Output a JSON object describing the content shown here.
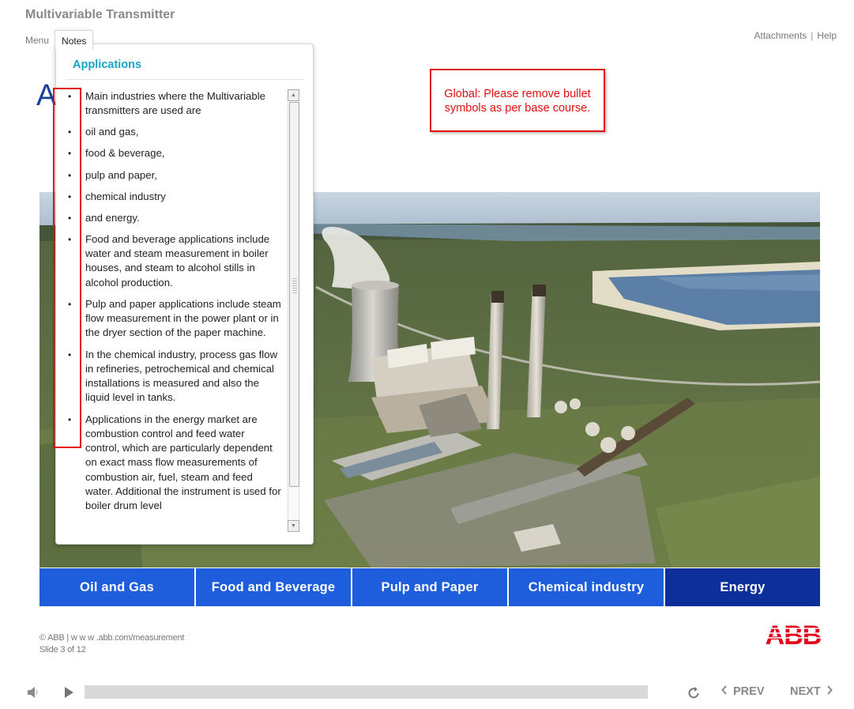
{
  "course": {
    "title": "Multivariable Transmitter"
  },
  "top_nav": {
    "menu": "Menu",
    "notes": "Notes",
    "attachments": "Attachments",
    "separator": "|",
    "help": "Help"
  },
  "slide": {
    "heading_partial": "A"
  },
  "notes": {
    "title": "Applications",
    "items": [
      "Main industries where the Multivariable transmitters are used are",
      "oil and gas,",
      "food & beverage,",
      "pulp and paper,",
      "chemical industry",
      "and energy.",
      "Food and beverage applications include water and steam measurement in boiler houses, and steam to alcohol stills in alcohol production.",
      "Pulp and paper applications include steam flow measurement in the power plant or in the dryer section of the paper machine.",
      "In the chemical industry, process gas flow in refineries, petrochemical and chemical installations is measured and also the liquid level in tanks.",
      "Applications in the energy market are combustion control and feed water control, which are particularly dependent on exact mass flow measurements of combustion air, fuel, steam and feed water.  Additional the instrument is used for boiler drum level"
    ]
  },
  "review_comment": "Global: Please remove bullet symbols as per base course.",
  "industry_tabs": [
    {
      "label": "Oil and Gas",
      "active": false
    },
    {
      "label": "Food and Beverage",
      "active": false
    },
    {
      "label": "Pulp and Paper",
      "active": false
    },
    {
      "label": "Chemical industry",
      "active": false
    },
    {
      "label": "Energy",
      "active": true
    }
  ],
  "footer": {
    "copyright": "© ABB | w w w .abb.com/measurement",
    "slide_counter": "Slide 3 of 12"
  },
  "logo": {
    "text": "ABB",
    "color": "#e2001a"
  },
  "player": {
    "prev": "PREV",
    "next": "NEXT",
    "progress_fraction": 0.0
  },
  "colors": {
    "tab_blue": "#1e5edc",
    "tab_active": "#0d2f9b",
    "notes_title": "#17a5c6",
    "comment_red": "#e01010"
  },
  "icons": [
    "audio-icon",
    "play-icon",
    "replay-icon",
    "chevron-left-icon",
    "chevron-right-icon",
    "scroll-up-arrow-icon",
    "scroll-down-arrow-icon"
  ]
}
